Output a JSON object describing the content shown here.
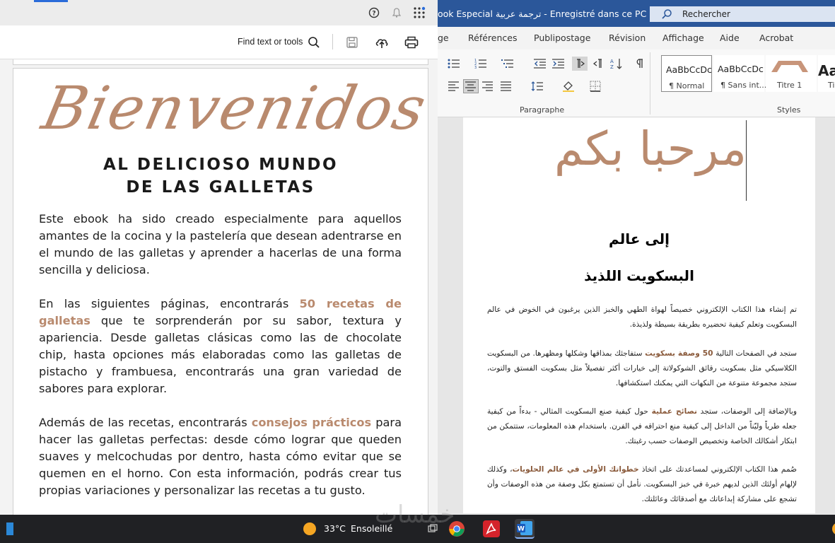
{
  "pdf_viewer": {
    "find_label": "Find text or tools",
    "heading_script": "Bienvenidos",
    "subheading_line1": "AL DELICIOSO MUNDO",
    "subheading_line2": "DE LAS GALLETAS",
    "paragraph1": "Este ebook ha sido creado especialmente para aquellos amantes de la cocina y la pastelería que desean adentrarse en el mundo de las galletas y aprender a hacerlas de una forma sencilla y deliciosa.",
    "paragraph2_pre": "En las siguientes páginas, encontrarás ",
    "paragraph2_highlight": "50 recetas de galletas",
    "paragraph2_post": " que te sorprenderán por su sabor, textura y apariencia. Desde galletas clásicas como las de chocolate chip, hasta opciones más elaboradas como las galletas de pistacho y frambuesa, encontrarás una gran variedad de sabores para explorar.",
    "paragraph3_pre": "Además de las recetas, encontrarás ",
    "paragraph3_highlight": "consejos prácticos",
    "paragraph3_post": " para hacer las galletas perfectas: desde cómo lograr que queden suaves y melcochudas por dentro, hasta cómo evitar que se quemen en el horno. Con esta información, podrás crear tus propias variaciones y personalizar las recetas a tu gusto.",
    "accent_color": "#b98a6e",
    "icons": [
      "help-icon",
      "bell-icon",
      "apps-grid-icon",
      "search-icon",
      "save-icon",
      "upload-icon",
      "print-icon"
    ]
  },
  "word": {
    "title": "ook Especial ترجمة عربية  -  Enregistré dans ce PC",
    "search_label": "Rechercher",
    "tabs": [
      "ge",
      "Références",
      "Publipostage",
      "Révision",
      "Affichage",
      "Aide",
      "Acrobat"
    ],
    "paragraph_group_label": "Paragraphe",
    "styles_group_label": "Styles",
    "styles": [
      {
        "preview": "AaBbCcDc",
        "name": "¶ Normal"
      },
      {
        "preview": "AaBbCcDc",
        "name": "¶ Sans int..."
      },
      {
        "preview": "",
        "name": "Titre 1"
      },
      {
        "preview": "Aa",
        "name": "Ti"
      }
    ],
    "doc_title_script": "مرحبا بكم",
    "doc_heading1": "إلى عالم",
    "doc_heading2": "البسكويت اللذيذ",
    "doc_para1": "تم إنشاء هذا الكتاب الإلكتروني خصيصاً لهواة الطهي والخبز الذين يرغبون في الخوض في عالم البسكويت وتعلم كيفية تحضيره بطريقة بسيطة ولذيذة.",
    "doc_para2_pre": "ستجد في الصفحات التالية ",
    "doc_para2_highlight": "50 وصفة بسكويت",
    "doc_para2_post": " ستفاجئك بمذاقها وشكلها ومظهرها. من البسكويت الكلاسيكي مثل بسكويت رقائق الشوكولاتة إلى خيارات أكثر تفصيلاً مثل بسكويت الفستق والتوت، ستجد مجموعة متنوعة من النكهات التي يمكنك استكشافها.",
    "doc_para3_pre": "وبالإضافة إلى الوصفات، ستجد ",
    "doc_para3_highlight": "نصائح عملية",
    "doc_para3_post": " حول كيفية صنع البسكويت المثالي - بدءاً من كيفية جعله طرياً وليّناً من الداخل إلى كيفية منع احتراقه في الفرن. باستخدام هذه المعلومات، ستتمكن من ابتكار أشكالك الخاصة وتخصيص الوصفات حسب رغبتك.",
    "doc_para4_pre": "صُمم هذا الكتاب الإلكتروني لمساعدتك على اتخاذ ",
    "doc_para4_highlight": "خطواتك الأولى في عالم الحلويات",
    "doc_para4_post": "، وكذلك لإلهام أولئك الذين لديهم خبرة في خبز البسكويت. نأمل أن تستمتع بكل وصفة من هذه الوصفات وأن تشجع على مشاركة إبداعاتك مع أصدقائك وعائلتك.",
    "brand_color": "#2b579a"
  },
  "taskbar": {
    "weather_temp": "33°C",
    "weather_desc": "Ensoleillé",
    "apps": [
      "chrome-icon",
      "acrobat-icon",
      "word-icon"
    ],
    "watermark": "خمسات"
  }
}
